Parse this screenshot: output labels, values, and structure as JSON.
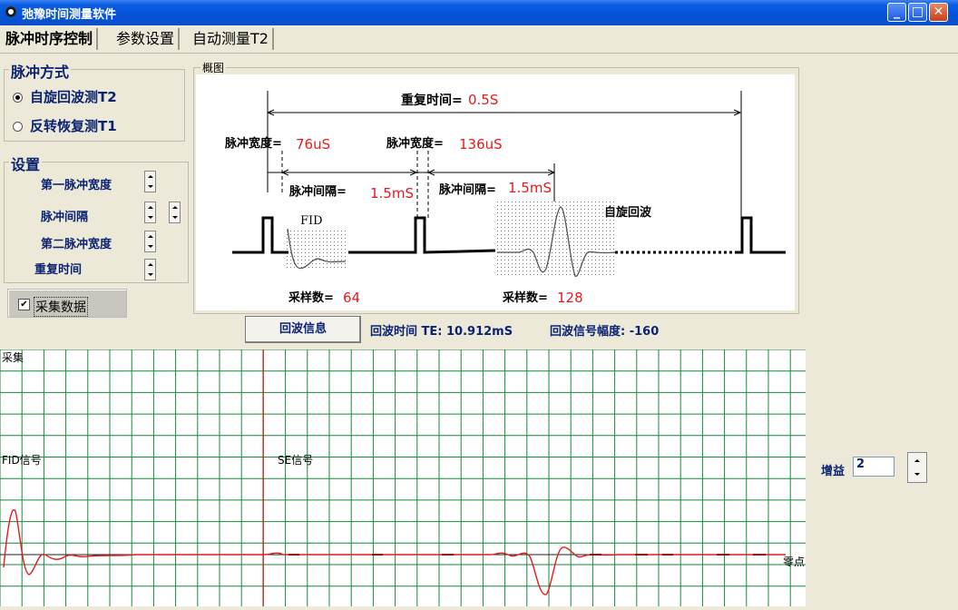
{
  "window": {
    "title": "弛豫时间测量软件",
    "buttons": {
      "minimize": "_",
      "maximize": "□",
      "close": "✕"
    }
  },
  "tabs": [
    {
      "label": "脉冲时序控制"
    },
    {
      "label": "参数设置"
    },
    {
      "label": "自动测量T2"
    }
  ],
  "pulse_mode": {
    "title": "脉冲方式",
    "options": [
      {
        "label": "自旋回波测T2",
        "selected": true
      },
      {
        "label": "反转恢复测T1",
        "selected": false
      }
    ]
  },
  "settings": {
    "title": "设置",
    "items": [
      {
        "label": "第一脉冲宽度"
      },
      {
        "label": "脉冲间隔"
      },
      {
        "label": "第二脉冲宽度"
      },
      {
        "label": "重复时间"
      }
    ]
  },
  "acquire": {
    "label": "采集数据",
    "checked": true,
    "check_mark": "✔"
  },
  "diagram": {
    "title": "概图",
    "repeat_label": "重复时间=",
    "repeat_value": "0.5S",
    "pw1_label": "脉冲宽度=",
    "pw1_value": "76uS",
    "pw2_label": "脉冲宽度=",
    "pw2_value": "136uS",
    "gap1_label": "脉冲间隔=",
    "gap1_value": "1.5mS",
    "gap2_label": "脉冲间隔=",
    "gap2_value": "1.5mS",
    "fid_label": "FID",
    "echo_label": "自旋回波",
    "samples1_label": "采样数=",
    "samples1_value": "64",
    "samples2_label": "采样数=",
    "samples2_value": "128"
  },
  "echo": {
    "button_label": "回波信息",
    "time_text": "回波时间 TE:  10.912mS",
    "amplitude_text": "回波信号幅度:  -160"
  },
  "scope": {
    "acquire_label": "采集",
    "fid_label": "FID信号",
    "se_label": "SE信号",
    "zero_label": "零点"
  },
  "gain": {
    "label": "增益",
    "value": "2"
  },
  "colors": {
    "titlebar": "#0553d8",
    "grid": "#178a3c",
    "signal": "#e8191c",
    "cursor": "#ff0000",
    "text_navy": "#0b2472"
  }
}
